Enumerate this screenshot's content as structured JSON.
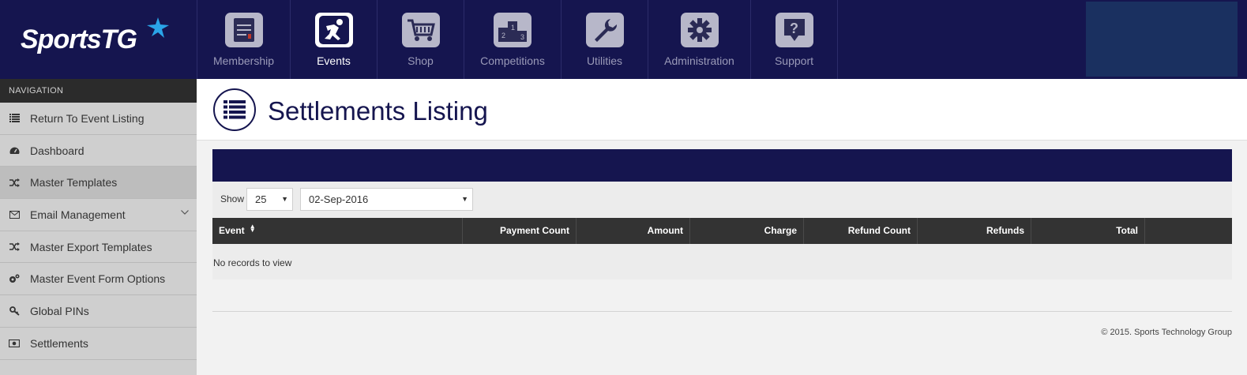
{
  "brand": {
    "name": "SportsTG",
    "tm": "™"
  },
  "topnav": {
    "items": [
      {
        "label": "Membership",
        "icon": "membership-icon",
        "active": false
      },
      {
        "label": "Events",
        "icon": "events-runner-icon",
        "active": true
      },
      {
        "label": "Shop",
        "icon": "shopping-cart-icon",
        "active": false
      },
      {
        "label": "Competitions",
        "icon": "podium-icon",
        "active": false
      },
      {
        "label": "Utilities",
        "icon": "wrench-icon",
        "active": false
      },
      {
        "label": "Administration",
        "icon": "gear-icon",
        "active": false
      },
      {
        "label": "Support",
        "icon": "question-icon",
        "active": false
      }
    ]
  },
  "sidebar": {
    "header": "NAVIGATION",
    "items": [
      {
        "label": "Return To Event Listing",
        "icon": "list-icon"
      },
      {
        "label": "Dashboard",
        "icon": "dashboard-icon"
      },
      {
        "label": "Master Templates",
        "icon": "shuffle-icon",
        "active": true
      },
      {
        "label": "Email Management",
        "icon": "envelope-icon",
        "expandable": true
      },
      {
        "label": "Master Export Templates",
        "icon": "shuffle-icon"
      },
      {
        "label": "Master Event Form Options",
        "icon": "cogs-icon"
      },
      {
        "label": "Global PINs",
        "icon": "key-icon"
      },
      {
        "label": "Settlements",
        "icon": "money-icon"
      }
    ]
  },
  "page": {
    "title": "Settlements Listing"
  },
  "controls": {
    "show_label": "Show",
    "page_size": "25",
    "date": "02-Sep-2016"
  },
  "table": {
    "columns": [
      "Event",
      "Payment Count",
      "Amount",
      "Charge",
      "Refund Count",
      "Refunds",
      "Total"
    ],
    "empty_text": "No records to view"
  },
  "footer": {
    "copyright": "© 2015. Sports Technology Group"
  },
  "colors": {
    "navy": "#15154f",
    "sidebar": "#cfcfcf",
    "table_header": "#333333"
  }
}
